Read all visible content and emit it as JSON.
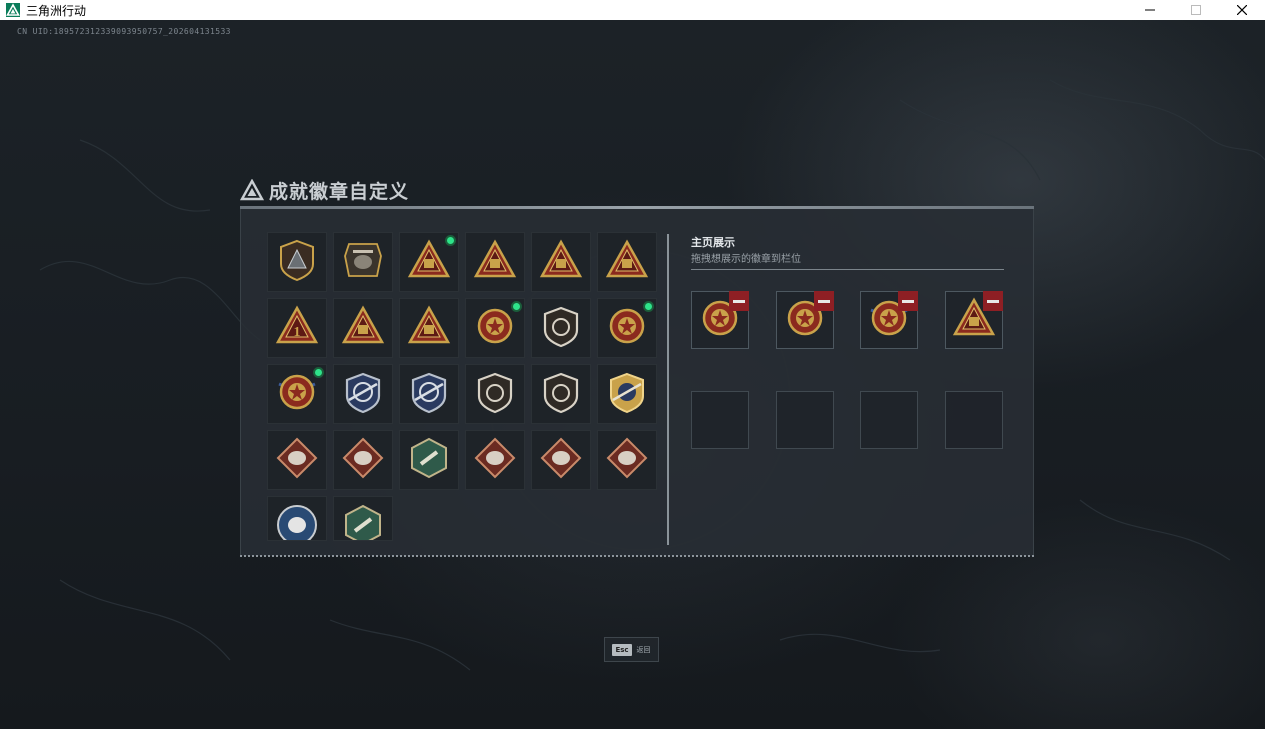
{
  "window": {
    "title": "三角洲行动"
  },
  "uid": "CN UID:18957231233909395​0757_202604131533",
  "panel": {
    "title": "成就徽章自定义",
    "section_title": "主页展示",
    "section_hint": "拖拽想展示的徽章到栏位"
  },
  "badges": [
    {
      "icon": "shield-triangle-badge-icon",
      "new": false
    },
    {
      "icon": "helicopter-badge-icon",
      "new": false
    },
    {
      "icon": "eye-triangle-badge-icon",
      "new": true
    },
    {
      "icon": "tank-triangle-badge-icon",
      "new": false
    },
    {
      "icon": "building-triangle-badge-icon",
      "new": false
    },
    {
      "icon": "ship-triangle-badge-icon",
      "new": false
    },
    {
      "icon": "number-one-triangle-badge-icon",
      "new": false
    },
    {
      "icon": "gear-triangle-badge-icon",
      "new": false
    },
    {
      "icon": "soldiers-triangle-badge-icon",
      "new": false
    },
    {
      "icon": "star-medal-badge-icon",
      "new": true
    },
    {
      "icon": "emblem-shield-badge-icon",
      "new": false
    },
    {
      "icon": "gold-medal-badge-icon",
      "new": true
    },
    {
      "icon": "winged-medal-badge-icon",
      "new": true
    },
    {
      "icon": "blue-rifle-shield-badge-icon",
      "new": false
    },
    {
      "icon": "blue-rifle-shield-2-badge-icon",
      "new": false
    },
    {
      "icon": "crosshair-shield-badge-icon",
      "new": false
    },
    {
      "icon": "fist-shield-badge-icon",
      "new": false
    },
    {
      "icon": "gold-rifle-shield-badge-icon",
      "new": false
    },
    {
      "icon": "beast-diamond-badge-icon",
      "new": false
    },
    {
      "icon": "beast-diamond-2-badge-icon",
      "new": false
    },
    {
      "icon": "soldier-hexagon-badge-icon",
      "new": false
    },
    {
      "icon": "dragon-diamond-badge-icon",
      "new": false
    },
    {
      "icon": "dragon-diamond-2-badge-icon",
      "new": false
    },
    {
      "icon": "runner-diamond-badge-icon",
      "new": false
    },
    {
      "icon": "blue-round-beast-badge-icon",
      "new": false
    },
    {
      "icon": "dragonfly-hexagon-badge-icon",
      "new": false
    }
  ],
  "showcase_slots": [
    {
      "filled": true,
      "icon": "gold-medal-badge-icon"
    },
    {
      "filled": true,
      "icon": "star-medal-badge-icon"
    },
    {
      "filled": true,
      "icon": "winged-medal-badge-icon"
    },
    {
      "filled": true,
      "icon": "eye-triangle-badge-icon"
    },
    {
      "filled": false
    },
    {
      "filled": false
    },
    {
      "filled": false
    },
    {
      "filled": false
    }
  ],
  "footer": {
    "esc_key": "Esc",
    "esc_label": "返回"
  },
  "colors": {
    "accent_new": "#2ee38a",
    "remove": "#8e1f24",
    "badge_gold": "#c9a24a",
    "badge_red": "#8b2a1e"
  }
}
